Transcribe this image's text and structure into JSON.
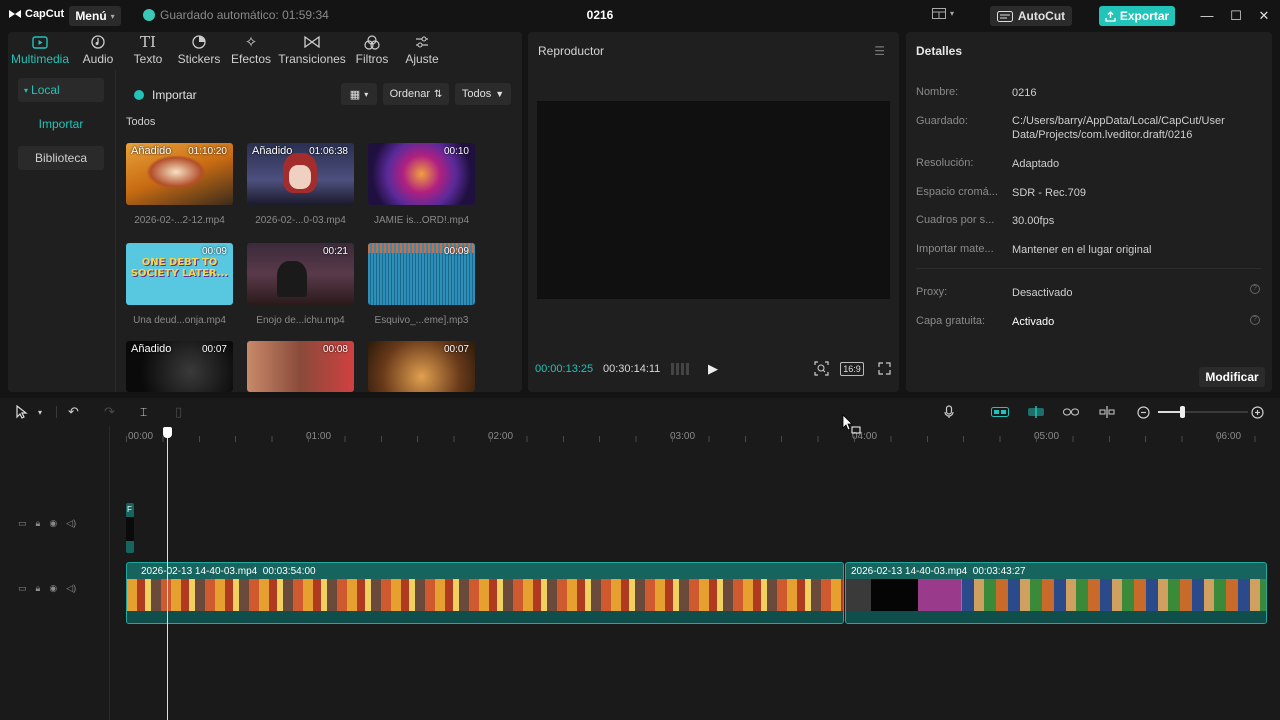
{
  "app": {
    "logo_text": "CapCut",
    "menu_label": "Menú",
    "autosave_text": "Guardado automático: 01:59:34",
    "project_title": "0216",
    "autocut_label": "AutoCut",
    "export_label": "Exportar"
  },
  "media": {
    "tabs": [
      {
        "label": "Multimedia",
        "icon": "media-icon"
      },
      {
        "label": "Audio",
        "icon": "audio-icon"
      },
      {
        "label": "Texto",
        "icon": "text-icon"
      },
      {
        "label": "Stickers",
        "icon": "sticker-icon"
      },
      {
        "label": "Efectos",
        "icon": "effects-icon"
      },
      {
        "label": "Transiciones",
        "icon": "transitions-icon"
      },
      {
        "label": "Filtros",
        "icon": "filters-icon"
      },
      {
        "label": "Ajuste",
        "icon": "adjust-icon"
      }
    ],
    "sidebar": {
      "local": "Local",
      "import": "Importar",
      "library": "Biblioteca"
    },
    "import_label": "Importar",
    "sort_label": "Ordenar",
    "filter_label": "Todos",
    "section_label": "Todos",
    "items": [
      {
        "tag": "Añadido",
        "duration": "01:10:20",
        "name": "2026-02-...2-12.mp4"
      },
      {
        "tag": "Añadido",
        "duration": "01:06:38",
        "name": "2026-02-...0-03.mp4"
      },
      {
        "tag": "",
        "duration": "00:10",
        "name": "JAMIE is...ORD!.mp4"
      },
      {
        "tag": "",
        "duration": "00:09",
        "name": "Una deud...onja.mp4",
        "caption": "ONE DEBT TO SOCIETY LATER..."
      },
      {
        "tag": "",
        "duration": "00:21",
        "name": "Enojo de...ichu.mp4"
      },
      {
        "tag": "",
        "duration": "00:09",
        "name": "Esquivo_...eme].mp3"
      },
      {
        "tag": "Añadido",
        "duration": "00:07",
        "name": ""
      },
      {
        "tag": "",
        "duration": "00:08",
        "name": ""
      },
      {
        "tag": "",
        "duration": "00:07",
        "name": ""
      }
    ]
  },
  "player": {
    "title": "Reproductor",
    "current_time": "00:00:13:25",
    "total_time": "00:30:14:11",
    "ratio_label": "16:9"
  },
  "details": {
    "title": "Detalles",
    "rows": [
      {
        "label": "Nombre:",
        "value": "0216"
      },
      {
        "label": "Guardado:",
        "value": "C:/Users/barry/AppData/Local/CapCut/User Data/Projects/com.lveditor.draft/0216"
      },
      {
        "label": "Resolución:",
        "value": "Adaptado"
      },
      {
        "label": "Espacio cromá...",
        "value": "SDR - Rec.709"
      },
      {
        "label": "Cuadros por s...",
        "value": "30.00fps"
      },
      {
        "label": "Importar mate...",
        "value": "Mantener en el lugar original"
      },
      {
        "label": "Proxy:",
        "value": "Desactivado"
      },
      {
        "label": "Capa gratuita:",
        "value": "Activado"
      }
    ],
    "modify_label": "Modificar"
  },
  "timeline": {
    "ruler": [
      "00:00",
      "01:00",
      "02:00",
      "03:00",
      "04:00",
      "05:00",
      "06:00"
    ],
    "clips": [
      {
        "name": "2026-02-13 14-40-03.mp4",
        "duration": "00:03:54:00"
      },
      {
        "name": "2026-02-13 14-40-03.mp4",
        "duration": "00:03:43:27"
      }
    ],
    "small_clip_label": "F"
  },
  "colors": {
    "accent": "#22c3b8",
    "panel": "#1f1f1f",
    "background": "#141414",
    "clip": "#17645f"
  }
}
